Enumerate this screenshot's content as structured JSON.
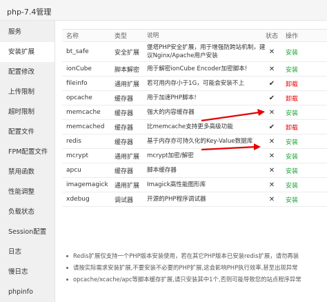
{
  "window": {
    "title": "php-7.4管理"
  },
  "sidebar": {
    "items": [
      {
        "label": "服务"
      },
      {
        "label": "安装扩展"
      },
      {
        "label": "配置修改"
      },
      {
        "label": "上传限制"
      },
      {
        "label": "超时限制"
      },
      {
        "label": "配置文件"
      },
      {
        "label": "FPM配置文件"
      },
      {
        "label": "禁用函数"
      },
      {
        "label": "性能调整"
      },
      {
        "label": "负载状态"
      },
      {
        "label": "Session配置"
      },
      {
        "label": "日志"
      },
      {
        "label": "慢日志"
      },
      {
        "label": "phpinfo"
      }
    ],
    "active_index": 1
  },
  "table": {
    "headers": {
      "name": "名称",
      "type": "类型",
      "desc": "说明",
      "status": "状态",
      "op": "操作"
    },
    "rows": [
      {
        "name": "bt_safe",
        "type": "安全扩展",
        "desc": "堡塔PHP安全扩展，用于增强防跨站机制，建议Nginx/Apache用户安装",
        "status": "✕",
        "op": "安装"
      },
      {
        "name": "ionCube",
        "type": "脚本解密",
        "desc": "用于解密ionCube Encoder加密脚本!",
        "status": "✕",
        "op": "安装"
      },
      {
        "name": "fileinfo",
        "type": "通用扩展",
        "desc": "若可用内存小于1G，可能会安装不上",
        "status": "✔",
        "op": "卸载"
      },
      {
        "name": "opcache",
        "type": "缓存器",
        "desc": "用于加速PHP脚本!",
        "status": "✔",
        "op": "卸载"
      },
      {
        "name": "memcache",
        "type": "缓存器",
        "desc": "强大的内容缓存器",
        "status": "✕",
        "op": "安装"
      },
      {
        "name": "memcached",
        "type": "缓存器",
        "desc": "比memcache支持更多高级功能",
        "status": "✔",
        "op": "卸载"
      },
      {
        "name": "redis",
        "type": "缓存器",
        "desc": "基于内存亦可持久化的Key-Value数据库",
        "status": "✕",
        "op": "安装"
      },
      {
        "name": "mcrypt",
        "type": "通用扩展",
        "desc": "mcrypt加密/解密",
        "status": "✕",
        "op": "安装"
      },
      {
        "name": "apcu",
        "type": "缓存器",
        "desc": "脚本缓存器",
        "status": "✕",
        "op": "安装"
      },
      {
        "name": "imagemagick",
        "type": "通用扩展",
        "desc": "Imagick高性能图形库",
        "status": "✕",
        "op": "安装"
      },
      {
        "name": "xdebug",
        "type": "调试器",
        "desc": "开源的PHP程序调试器",
        "status": "✕",
        "op": "安装"
      }
    ]
  },
  "tips": [
    "Redis扩展仅支持一个PHP版本安装使用，若在其它PHP版本已安装redis扩展，请勿再装",
    "请按实际需求安装扩展,不要安装不必要的PHP扩展,这会影响PHP执行效率,甚至出现异常",
    "opcache/xcache/apc等脚本缓存扩展,请只安装其中1个,否则可能导致您的站点程序异常"
  ],
  "colors": {
    "install": "#20a53a",
    "uninstall": "#e00000",
    "arrow": "#e60000",
    "active_bg": "#ffffff",
    "sidebar_bg": "#f0f0f0"
  }
}
